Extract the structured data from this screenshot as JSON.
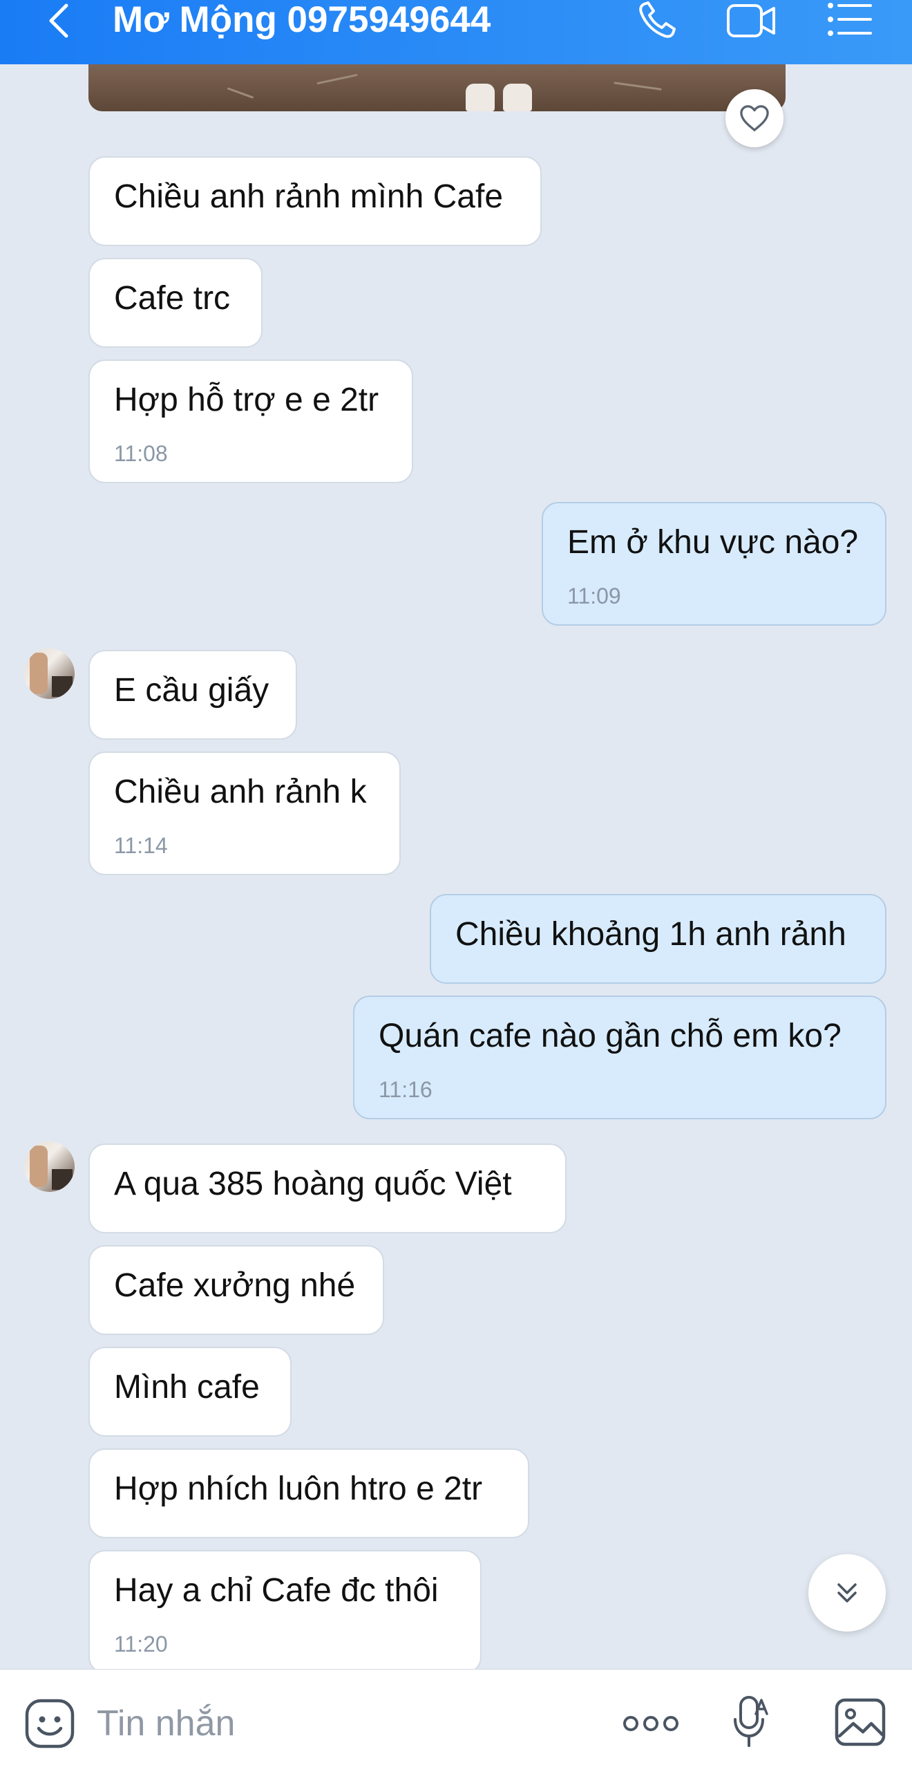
{
  "header": {
    "title": "Mơ Mộng 0975949644",
    "icons": [
      "back-arrow-icon",
      "phone-icon",
      "video-call-icon",
      "menu-list-icon"
    ]
  },
  "messages": [
    {
      "dir": "in",
      "text": "Chiều anh rảnh mình Cafe",
      "time": ""
    },
    {
      "dir": "in",
      "text": "Cafe trc",
      "time": ""
    },
    {
      "dir": "in",
      "text": "Hợp hỗ trợ e e 2tr",
      "time": "11:08"
    },
    {
      "dir": "out",
      "text": "Em ở khu vực nào?",
      "time": "11:09"
    },
    {
      "dir": "in",
      "text": "E cầu giấy",
      "time": ""
    },
    {
      "dir": "in",
      "text": "Chiều anh rảnh k",
      "time": "11:14"
    },
    {
      "dir": "out",
      "text": "Chiều khoảng 1h anh rảnh",
      "time": ""
    },
    {
      "dir": "out",
      "text": "Quán cafe nào gần chỗ em ko?",
      "time": "11:16"
    },
    {
      "dir": "in",
      "text": "A qua 385 hoàng quốc Việt",
      "time": ""
    },
    {
      "dir": "in",
      "text": "Cafe xưởng nhé",
      "time": ""
    },
    {
      "dir": "in",
      "text": "Mình cafe",
      "time": ""
    },
    {
      "dir": "in",
      "text": "Hợp nhích luôn htro e 2tr",
      "time": ""
    },
    {
      "dir": "in",
      "text": "Hay a chỉ Cafe đc thôi",
      "time": "11:20"
    }
  ],
  "composer": {
    "placeholder": "Tin nhắn",
    "icons": [
      "emoji-sticker-icon",
      "more-dots-icon",
      "voice-mic-icon",
      "image-gallery-icon"
    ]
  },
  "colors": {
    "header_gradient_start": "#1a7cf5",
    "header_gradient_end": "#3a9af8",
    "background": "#e2e8f1",
    "incoming_bubble": "#ffffff",
    "outgoing_bubble": "#d7ebfd",
    "timestamp": "#8b97a6"
  }
}
